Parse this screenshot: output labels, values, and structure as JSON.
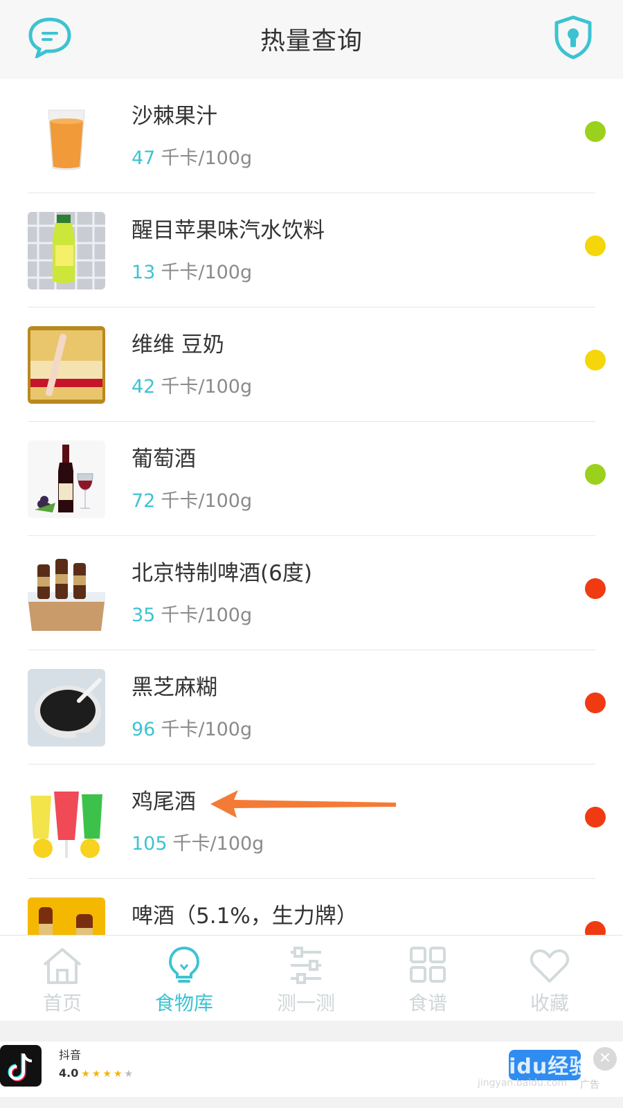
{
  "header": {
    "title": "热量查询",
    "left_icon": "chat-bubble-icon",
    "right_icon": "shield-lock-icon"
  },
  "foods": [
    {
      "name": "沙棘果汁",
      "calories": "47",
      "unit": "千卡/100g",
      "level_color": "#9bd11c",
      "image": "orange-juice-glass"
    },
    {
      "name": "醒目苹果味汽水饮料",
      "calories": "13",
      "unit": "千卡/100g",
      "level_color": "#f4d60a",
      "image": "green-soda-bottle"
    },
    {
      "name": "维维 豆奶",
      "calories": "42",
      "unit": "千卡/100g",
      "level_color": "#f4d60a",
      "image": "soy-milk-package"
    },
    {
      "name": "葡萄酒",
      "calories": "72",
      "unit": "千卡/100g",
      "level_color": "#9bd11c",
      "image": "wine-bottle-glass"
    },
    {
      "name": "北京特制啤酒(6度)",
      "calories": "35",
      "unit": "千卡/100g",
      "level_color": "#f03b12",
      "image": "beer-bottles-ice"
    },
    {
      "name": "黑芝麻糊",
      "calories": "96",
      "unit": "千卡/100g",
      "level_color": "#f03b12",
      "image": "black-sesame-paste"
    },
    {
      "name": "鸡尾酒",
      "calories": "105",
      "unit": "千卡/100g",
      "level_color": "#f03b12",
      "image": "cocktail-glasses"
    },
    {
      "name": "啤酒（5.1%，生力牌）",
      "calories": "",
      "unit": "",
      "level_color": "#f03b12",
      "image": "beer-bottles-yellow"
    }
  ],
  "tabs": [
    {
      "label": "首页",
      "icon": "home-icon",
      "active": false
    },
    {
      "label": "食物库",
      "icon": "lightbulb-icon",
      "active": true
    },
    {
      "label": "测一测",
      "icon": "sliders-icon",
      "active": false
    },
    {
      "label": "食谱",
      "icon": "grid-icon",
      "active": false
    },
    {
      "label": "收藏",
      "icon": "heart-icon",
      "active": false
    }
  ],
  "ad": {
    "app_name": "抖音",
    "rating": "4.0",
    "stars": 4,
    "tag": "广告",
    "close": "✕"
  },
  "watermark": {
    "text": "Baidu经验",
    "url": "jingyan.baidu.com"
  },
  "colors": {
    "accent": "#3cc3d2",
    "arrow": "#f47b35"
  }
}
